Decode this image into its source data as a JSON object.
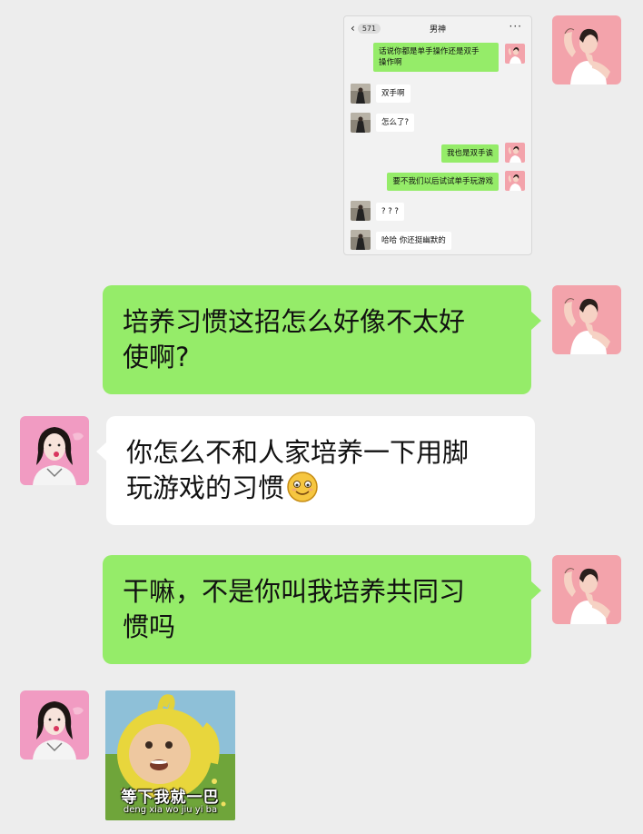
{
  "embedded_screenshot": {
    "back_badge": "571",
    "title": "男神",
    "more": "···",
    "messages": [
      {
        "side": "right",
        "text1": "话说你都是单手操作还是双手",
        "text2": "操作啊"
      },
      {
        "side": "left",
        "text": "双手啊"
      },
      {
        "side": "left",
        "text": "怎么了?"
      },
      {
        "side": "right",
        "text": "我也是双手诶"
      },
      {
        "side": "right",
        "text": "要不我们以后试试单手玩游戏"
      },
      {
        "side": "left",
        "text": "? ? ?"
      },
      {
        "side": "left",
        "text": "哈哈 你还挺幽默的"
      }
    ]
  },
  "messages": [
    {
      "side": "right",
      "line1": "培养习惯这招怎么好像不太好",
      "line2": "使啊?"
    },
    {
      "side": "left",
      "line1": "你怎么不和人家培养一下用脚",
      "line2": "玩游戏的习惯",
      "emoji": "smile-emoji"
    },
    {
      "side": "right",
      "line1": "干嘛，不是你叫我培养共同习",
      "line2": "惯吗"
    }
  ],
  "sticker": {
    "caption": "等下我就一巴",
    "pinyin": "deng xia wo jiu yi ba"
  },
  "colors": {
    "background": "#ededed",
    "sent_bubble": "#95ec69",
    "received_bubble": "#ffffff"
  }
}
